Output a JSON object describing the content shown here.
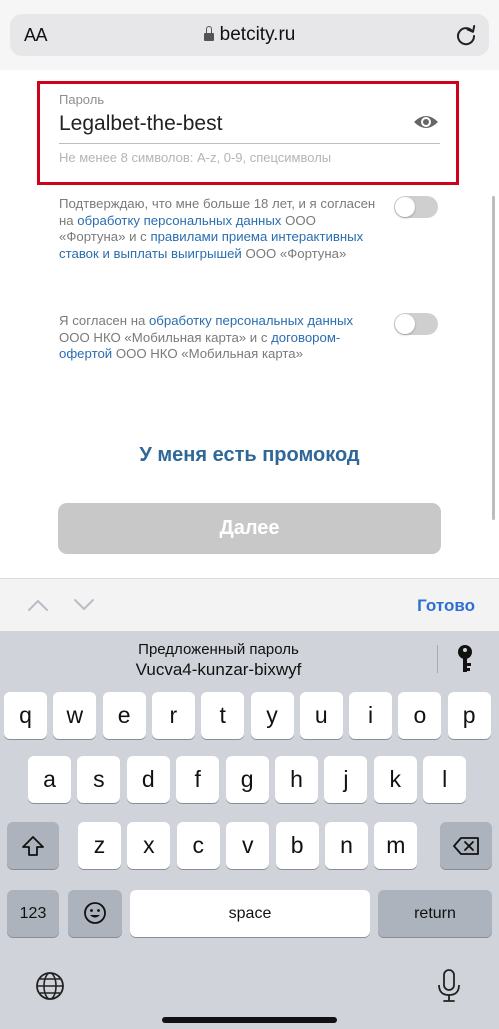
{
  "browser": {
    "text_size_label": "AA",
    "url": "betcity.ru"
  },
  "form": {
    "password_label": "Пароль",
    "password_value": "Legalbet-the-best",
    "password_hint": "Не менее 8 символов: A-z, 0-9, спецсимволы",
    "consent1": {
      "t1": "Подтверждаю, что мне больше 18 лет, и я согласен на ",
      "l1": "обработку персональных данных",
      "t2": " ООО «Фортуна» и с ",
      "l2": "правилами приема интерактивных ставок и выплаты выигрышей",
      "t3": " ООО «Фортуна»",
      "checked": false
    },
    "consent2": {
      "t1": "Я согласен на ",
      "l1": "обработку персональных данных",
      "t2": " ООО НКО «Мобильная карта» и с ",
      "l2": "договором-офертой",
      "t3": " ООО НКО «Мобильная карта»",
      "checked": false
    },
    "promo_label": "У меня есть промокод",
    "next_label": "Далее"
  },
  "accessory": {
    "done_label": "Готово"
  },
  "keyboard": {
    "suggest_title": "Предложенный пароль",
    "suggest_value": "Vucva4-kunzar-bixwyf",
    "row1": [
      "q",
      "w",
      "e",
      "r",
      "t",
      "y",
      "u",
      "i",
      "o",
      "p"
    ],
    "row2": [
      "a",
      "s",
      "d",
      "f",
      "g",
      "h",
      "j",
      "k",
      "l"
    ],
    "row3": [
      "z",
      "x",
      "c",
      "v",
      "b",
      "n",
      "m"
    ],
    "num_label": "123",
    "space_label": "space",
    "return_label": "return"
  },
  "colors": {
    "highlight_border": "#d0021b",
    "link": "#2a6db0",
    "promo": "#2f6898",
    "done": "#2f6fd1"
  },
  "icons": [
    "lock-icon",
    "reload-icon",
    "eye-icon",
    "chevron-up-icon",
    "chevron-down-icon",
    "key-icon",
    "shift-icon",
    "backspace-icon",
    "emoji-icon",
    "globe-icon",
    "microphone-icon"
  ]
}
